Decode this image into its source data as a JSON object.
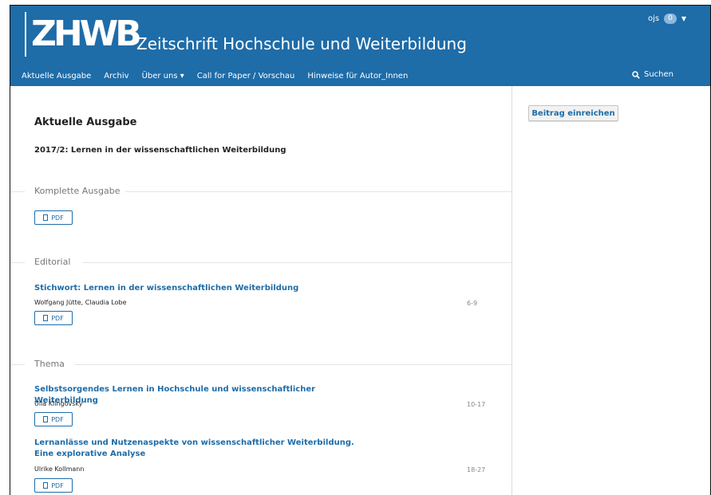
{
  "header": {
    "logo_text": "ZHWB",
    "site_title": "Zeitschrift Hochschule und Weiterbildung",
    "user": "ojs",
    "user_badge": "0"
  },
  "nav": {
    "items": [
      {
        "label": "Aktuelle Ausgabe"
      },
      {
        "label": "Archiv"
      },
      {
        "label": "Über uns ▾"
      },
      {
        "label": "Call for Paper / Vorschau"
      },
      {
        "label": "Hinweise für Autor_Innen"
      }
    ],
    "search_label": "Suchen"
  },
  "main": {
    "page_title": "Aktuelle Ausgabe",
    "issue_title": "2017/2: Lernen in der wissenschaftlichen Weiterbildung",
    "sections": [
      {
        "heading": "Komplette Ausgabe"
      },
      {
        "heading": "Editorial"
      },
      {
        "heading": "Thema"
      }
    ],
    "pdf_label": "PDF",
    "articles": [
      {
        "title": "Stichwort: Lernen in der wissenschaftlichen Weiterbildung",
        "authors": "Wolfgang Jütte, Claudia Lobe",
        "pages": "6-9"
      },
      {
        "title": "Selbstsorgendes Lernen in Hochschule und wissenschaftlicher Weiterbildung",
        "authors": "Ulla Klingovsky",
        "pages": "10-17"
      },
      {
        "title": "Lernanlässe und Nutzenaspekte von wissenschaftlicher Weiterbildung. Eine explorative Analyse",
        "authors": "Ulrike Kollmann",
        "pages": "18-27"
      }
    ]
  },
  "sidebar": {
    "submit_label": "Beitrag einreichen"
  },
  "colors": {
    "brand": "#1e6ca8",
    "badge": "#8fb7dc"
  }
}
